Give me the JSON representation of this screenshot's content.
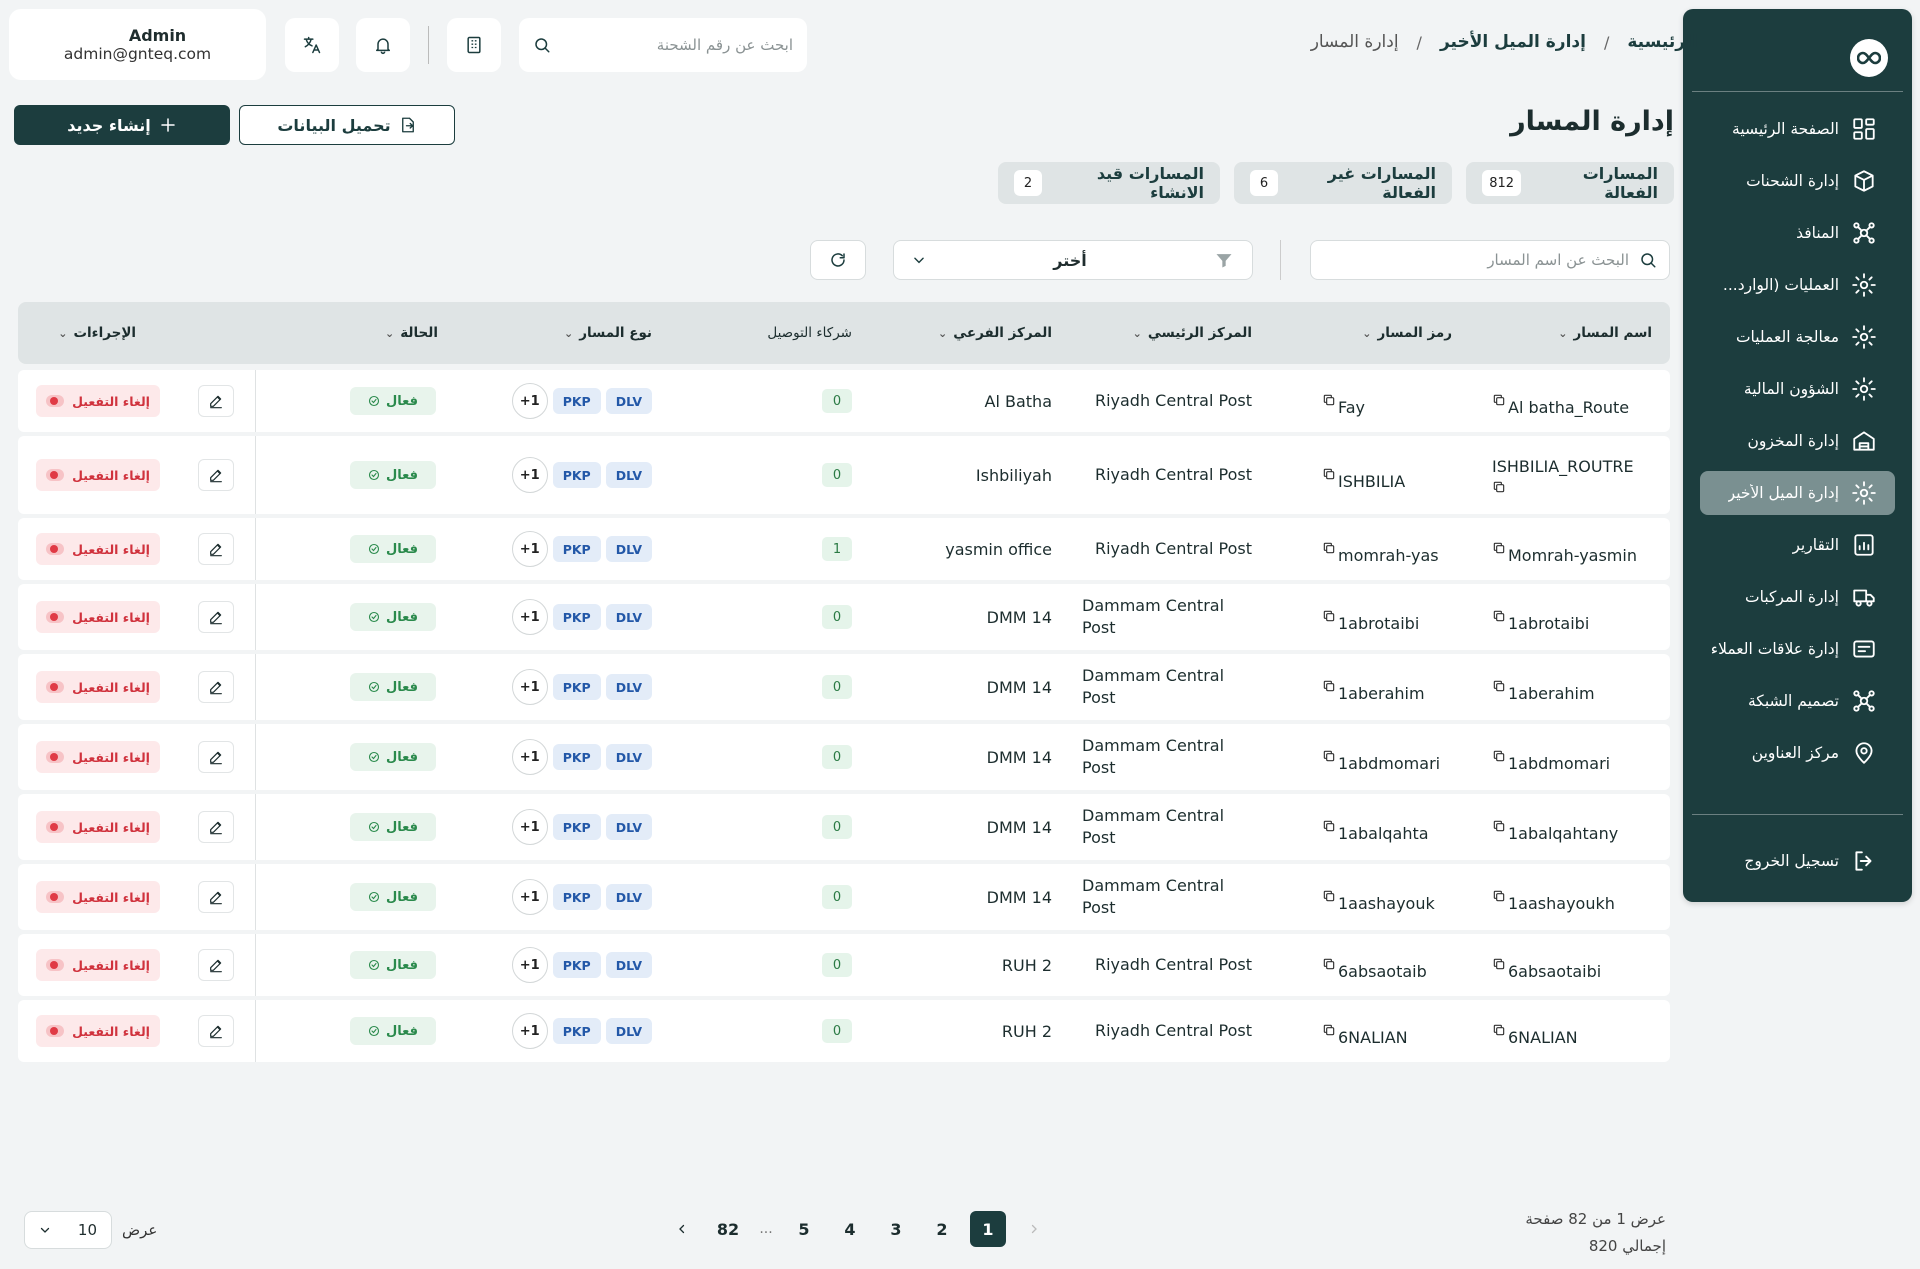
{
  "user": {
    "name": "Admin",
    "email": "admin@gnteq.com"
  },
  "breadcrumb": {
    "home": "الرئيسية",
    "section": "إدارة الميل الأخير",
    "current": "إدارة المسار",
    "sep": "/"
  },
  "header": {
    "search_placeholder": "ابحث عن رقم الشحنة"
  },
  "sidebar": {
    "items": [
      {
        "label": "الصفحة الرئيسية",
        "icon": "dashboard-icon"
      },
      {
        "label": "إدارة الشحنات",
        "icon": "box-icon"
      },
      {
        "label": "المنافذ",
        "icon": "network-icon"
      },
      {
        "label": "العمليات (الوارد...",
        "icon": "gear-icon"
      },
      {
        "label": "معالجة العمليات",
        "icon": "gear-icon"
      },
      {
        "label": "الشؤون المالية",
        "icon": "gear-icon"
      },
      {
        "label": "إدارة المخزون",
        "icon": "warehouse-icon"
      },
      {
        "label": "إدارة الميل الأخير",
        "icon": "gear-icon",
        "active": true
      },
      {
        "label": "التقارير",
        "icon": "report-icon"
      },
      {
        "label": "إدارة المركبات",
        "icon": "truck-icon"
      },
      {
        "label": "إدارة علاقات العملاء",
        "icon": "crm-icon"
      },
      {
        "label": "تصميم الشبكة",
        "icon": "network-icon"
      },
      {
        "label": "مركز العناوين",
        "icon": "location-icon"
      }
    ],
    "logout": "تسجيل الخروج"
  },
  "page": {
    "title": "إدارة المسار",
    "new_button": "إنشاء جديد",
    "load_button": "تحميل البيانات"
  },
  "tabs": [
    {
      "label": "المسارات الفعالة",
      "count": "812"
    },
    {
      "label": "المسارات غير الفعالة",
      "count": "6"
    },
    {
      "label": "المسارات قيد الانشاء",
      "count": "2"
    }
  ],
  "filters": {
    "search_placeholder": "البحث عن اسم المسار",
    "select_value": "أختر"
  },
  "table": {
    "headers": {
      "name": "اسم المسار",
      "code": "رمز المسار",
      "main": "المركز الرئيسي",
      "sub": "المركز الفرعي",
      "partners": "شركاء التوصيل",
      "type": "نوع المسار",
      "status": "الحالة",
      "actions": "الإجراءات"
    },
    "chip1": "DLV",
    "chip2": "PKP",
    "more": "1+",
    "status_label": "فعال",
    "deactivate_label": "إلغاء التفعيل",
    "rows": [
      {
        "name": "Al batha_Route",
        "code": "Fay",
        "main": "Riyadh Central Post",
        "sub": "Al Batha",
        "partners": "0"
      },
      {
        "name": "ISHBILIA_ROUTRE",
        "code": "ISHBILIA",
        "main": "Riyadh Central Post",
        "sub": "Ishbiliyah",
        "partners": "0"
      },
      {
        "name": "Momrah-yasmin",
        "code": "momrah-yas",
        "main": "Riyadh Central Post",
        "sub": "yasmin office",
        "partners": "1"
      },
      {
        "name": "1abrotaibi",
        "code": "1abrotaibi",
        "main": "Dammam Central Post",
        "sub": "DMM 14",
        "partners": "0"
      },
      {
        "name": "1aberahim",
        "code": "1aberahim",
        "main": "Dammam Central Post",
        "sub": "DMM 14",
        "partners": "0"
      },
      {
        "name": "1abdmomari",
        "code": "1abdmomari",
        "main": "Dammam Central Post",
        "sub": "DMM 14",
        "partners": "0"
      },
      {
        "name": "1abalqahtany",
        "code": "1abalqahta",
        "main": "Dammam Central Post",
        "sub": "DMM 14",
        "partners": "0"
      },
      {
        "name": "1aashayoukh",
        "code": "1aashayouk",
        "main": "Dammam Central Post",
        "sub": "DMM 14",
        "partners": "0"
      },
      {
        "name": "6absaotaibi",
        "code": "6absaotaib",
        "main": "Riyadh Central Post",
        "sub": "RUH 2",
        "partners": "0"
      },
      {
        "name": "6NALIAN",
        "code": "6NALIAN",
        "main": "Riyadh Central Post",
        "sub": "RUH 2",
        "partners": "0"
      }
    ]
  },
  "pagination": {
    "pages": [
      "1",
      "2",
      "3",
      "4",
      "5"
    ],
    "ellipsis": "...",
    "last": "82",
    "current": "1",
    "info_line1": "عرض 1 من 82 صفحة",
    "info_line2": "إجمالي 820",
    "show_label": "عرض",
    "page_size": "10"
  }
}
